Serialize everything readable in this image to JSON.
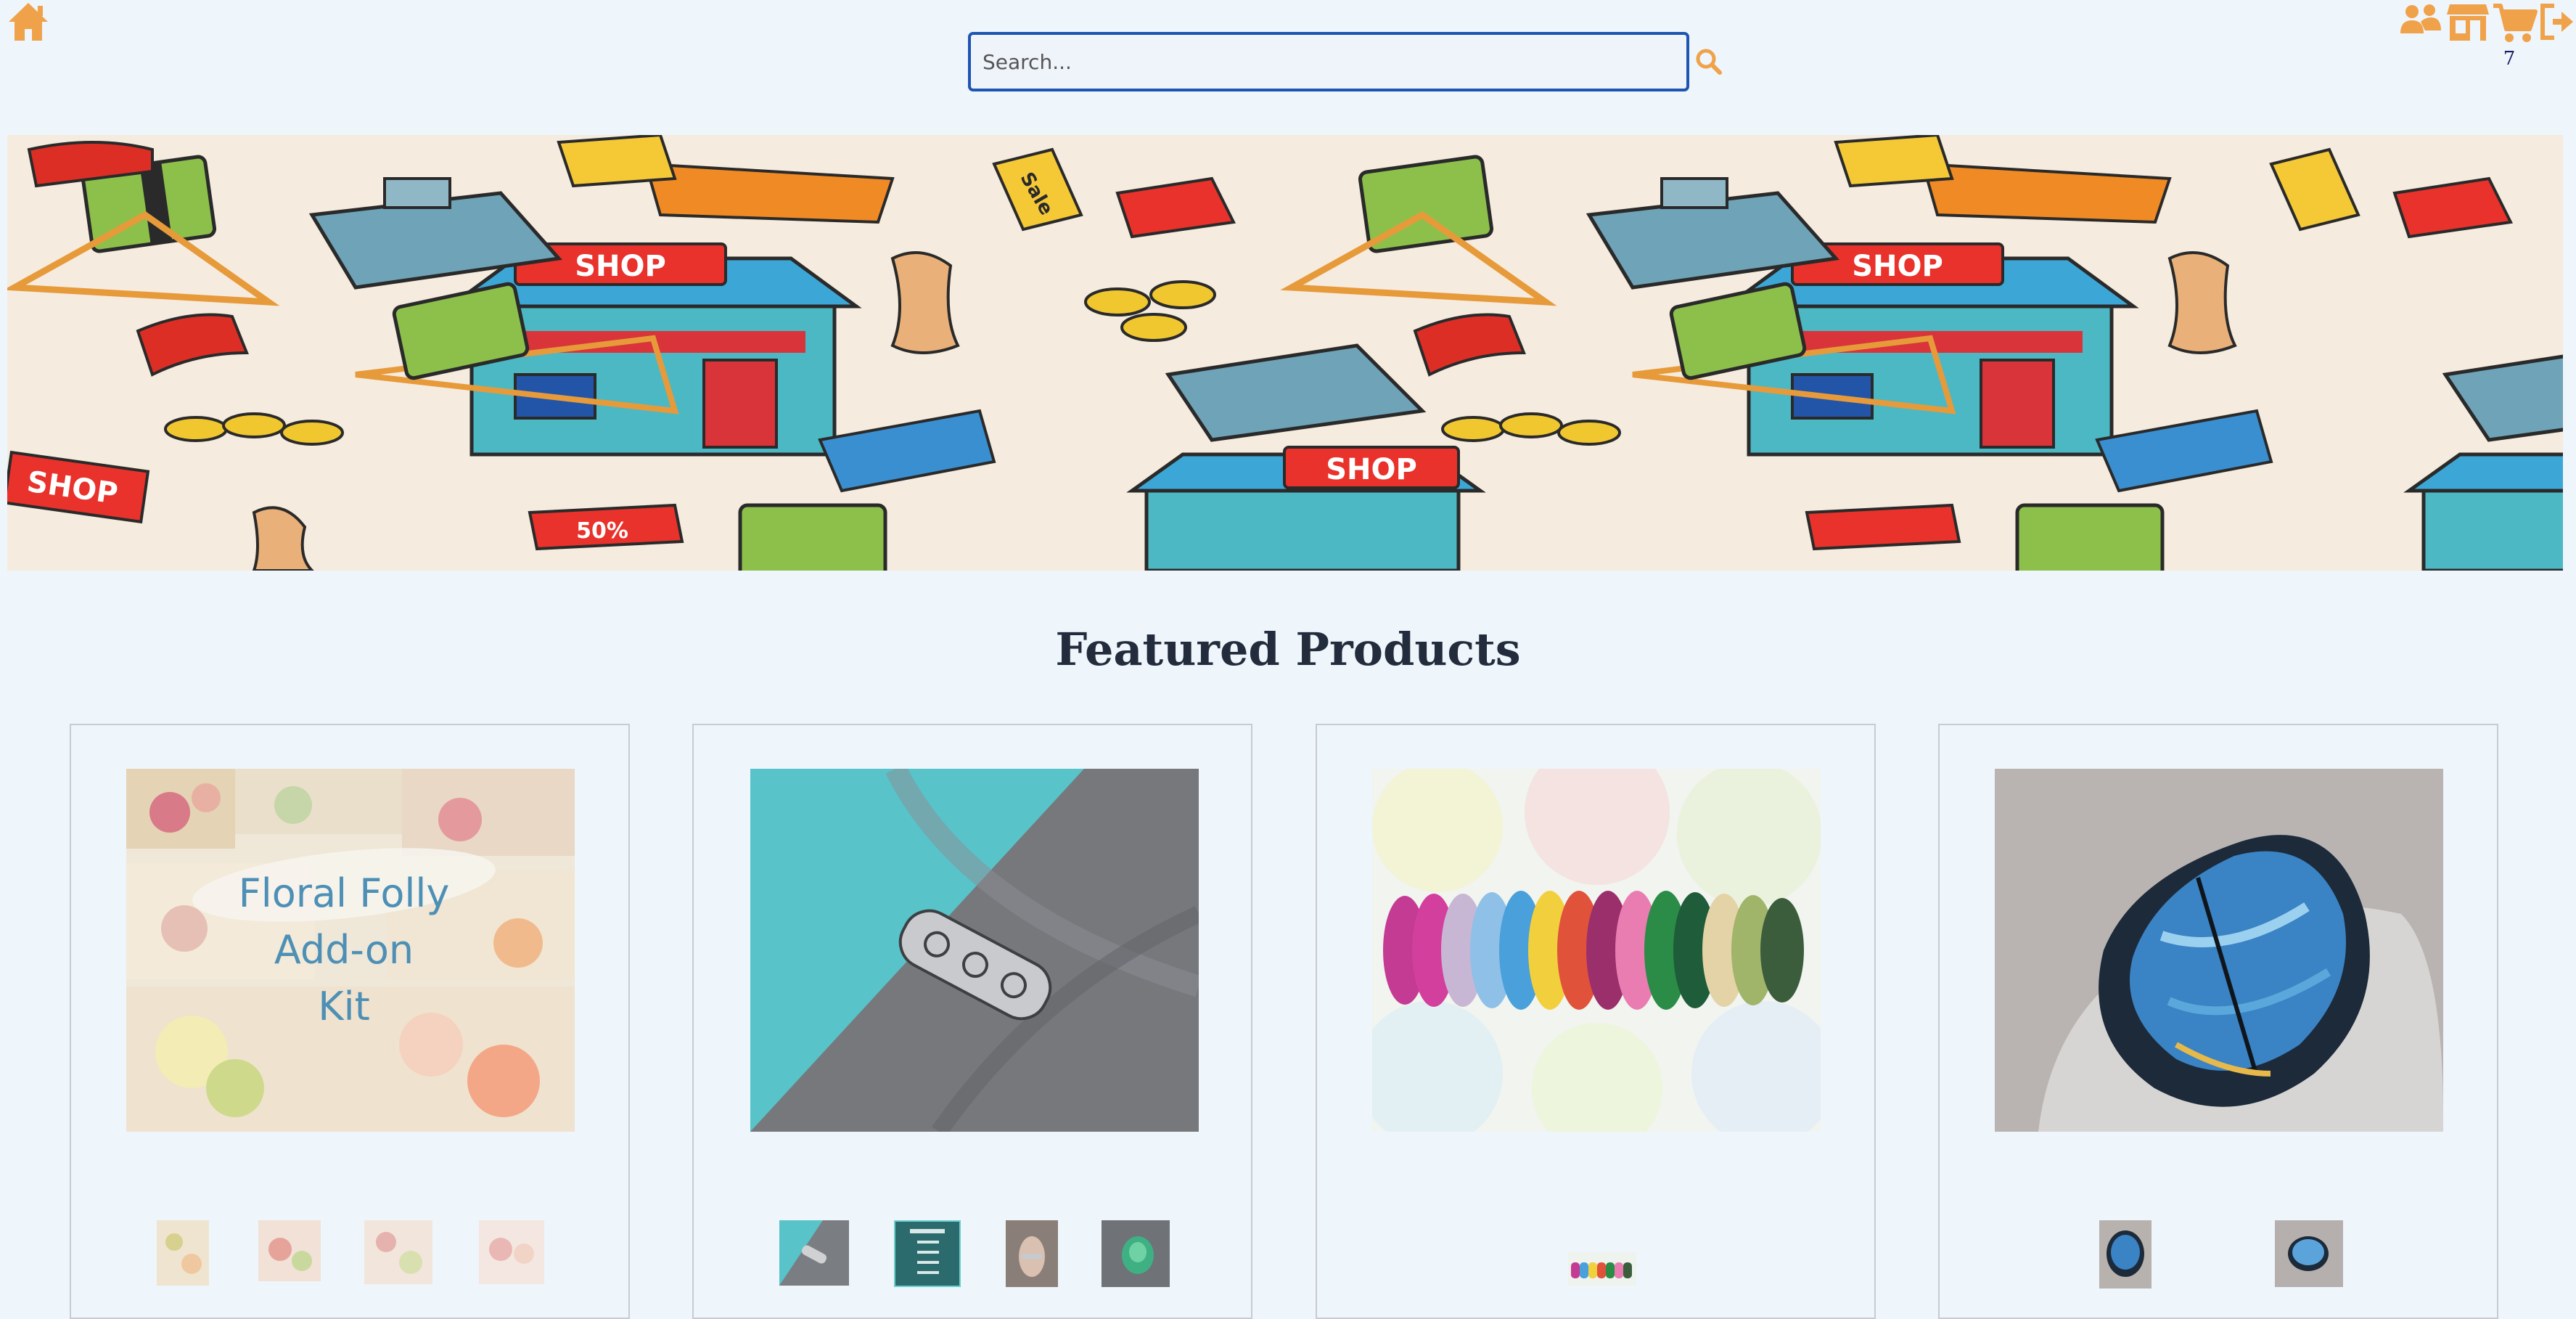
{
  "header": {
    "search_placeholder": "Search...",
    "cart_count": "7",
    "icons": [
      "home-icon",
      "search-icon",
      "users-icon",
      "store-icon",
      "cart-icon",
      "logout-icon"
    ],
    "accent_color": "#f0a24a"
  },
  "banner": {
    "labels": [
      "SHOP",
      "SHOP",
      "SHOP",
      "SHOP",
      "Sale",
      "50%"
    ]
  },
  "featured": {
    "title": "Featured Products",
    "products": [
      {
        "image_text": [
          "Floral Folly",
          "Add-on",
          "Kit"
        ],
        "thumbnail_count": 4
      },
      {
        "image_text": [],
        "thumbnail_count": 4
      },
      {
        "image_text": [],
        "thumbnail_count": 1
      },
      {
        "image_text": [],
        "thumbnail_count": 2
      }
    ]
  }
}
